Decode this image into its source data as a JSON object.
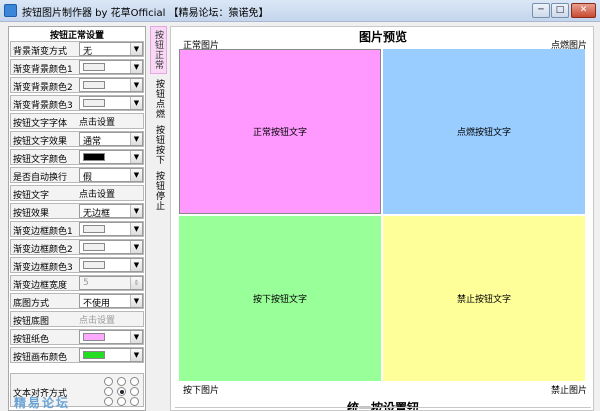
{
  "window": {
    "title": "按钮图片制作器 by 花草Official 【精易论坛：猿诺免】",
    "controls": {
      "minimize": "─",
      "maximize": "□",
      "close": "✕"
    },
    "icon": "app-icon"
  },
  "settings": {
    "title": "按钮正常设置",
    "rows": [
      {
        "label": "背景渐变方式",
        "kind": "dropdown",
        "value": "无"
      },
      {
        "label": "渐变背景颜色1",
        "kind": "color",
        "color": "#f0f0f0"
      },
      {
        "label": "渐变背景颜色2",
        "kind": "color",
        "color": "#f0f0f0"
      },
      {
        "label": "渐变背景颜色3",
        "kind": "color",
        "color": "#f0f0f0"
      },
      {
        "label": "按钮文字字体",
        "kind": "action",
        "value": "点击设置"
      },
      {
        "label": "按钮文字效果",
        "kind": "dropdown",
        "value": "通常"
      },
      {
        "label": "按钮文字颜色",
        "kind": "color",
        "color": "#000000"
      },
      {
        "label": "是否自动换行",
        "kind": "dropdown",
        "value": "假"
      },
      {
        "label": "按钮文字",
        "kind": "action",
        "value": "点击设置"
      },
      {
        "label": "按钮效果",
        "kind": "dropdown",
        "value": "无边框"
      },
      {
        "label": "渐变边框颜色1",
        "kind": "color",
        "color": "#f0f0f0"
      },
      {
        "label": "渐变边框颜色2",
        "kind": "color",
        "color": "#f0f0f0"
      },
      {
        "label": "渐变边框颜色3",
        "kind": "color",
        "color": "#f0f0f0"
      },
      {
        "label": "渐变边框宽度",
        "kind": "spin",
        "value": "5"
      },
      {
        "label": "底图方式",
        "kind": "dropdown",
        "value": "不使用"
      },
      {
        "label": "按钮底图",
        "kind": "action-disabled",
        "value": "点击设置"
      },
      {
        "label": "按钮纸色",
        "kind": "color",
        "color": "#ffaaff"
      },
      {
        "label": "按钮画布颜色",
        "kind": "color",
        "color": "#22dd22"
      }
    ],
    "align_label": "文本对齐方式",
    "align_selected": "middle-center"
  },
  "tabs": [
    {
      "label": "按钮正常",
      "selected": true
    },
    {
      "label": "按钮点燃",
      "selected": false
    },
    {
      "label": "按钮按下",
      "selected": false
    },
    {
      "label": "按钮停止",
      "selected": false
    }
  ],
  "preview": {
    "title": "图片预览",
    "corner_labels": {
      "top_left": "正常图片",
      "top_right": "点燃图片",
      "bottom_left": "按下图片",
      "bottom_right": "禁止图片"
    },
    "cells": {
      "normal": {
        "text": "正常按钮文字",
        "color": "#ff99ff"
      },
      "hover": {
        "text": "点燃按钮文字",
        "color": "#99ccff"
      },
      "pressed": {
        "text": "按下按钮文字",
        "color": "#99ff99"
      },
      "disabled": {
        "text": "禁止按钮文字",
        "color": "#ffff99"
      }
    }
  },
  "batch": {
    "title": "统一按设置钮"
  },
  "footer_logo": "精易论坛"
}
